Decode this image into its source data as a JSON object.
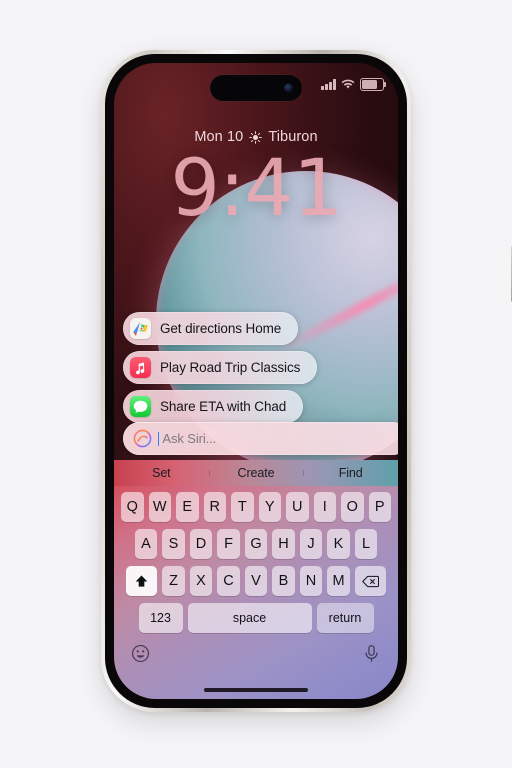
{
  "device": {
    "name": "iphone-15-pro",
    "frame_color": "#cfcac3"
  },
  "status_bar": {
    "signal_icon": "cellular-bars-icon",
    "wifi_icon": "wifi-icon",
    "battery_icon": "battery-icon"
  },
  "lock_screen": {
    "date": "Mon 10",
    "weather_icon": "sun-icon",
    "location": "Tiburon",
    "time": "9:41"
  },
  "siri": {
    "chips": [
      {
        "icon": "maps-app-icon",
        "label": "Get directions Home"
      },
      {
        "icon": "music-app-icon",
        "label": "Play Road Trip Classics"
      },
      {
        "icon": "messages-app-icon",
        "label": "Share ETA with Chad"
      }
    ],
    "input": {
      "icon": "siri-orb-icon",
      "placeholder": "Ask Siri...",
      "value": ""
    },
    "tabs": [
      {
        "label": "Set"
      },
      {
        "label": "Create"
      },
      {
        "label": "Find"
      }
    ]
  },
  "keyboard": {
    "row1": [
      "Q",
      "W",
      "E",
      "R",
      "T",
      "Y",
      "U",
      "I",
      "O",
      "P"
    ],
    "row2": [
      "A",
      "S",
      "D",
      "F",
      "G",
      "H",
      "J",
      "K",
      "L"
    ],
    "row3": [
      "Z",
      "X",
      "C",
      "V",
      "B",
      "N",
      "M"
    ],
    "shift_icon": "shift-up-arrow-icon",
    "backspace_icon": "backspace-delete-icon",
    "numbers_label": "123",
    "space_label": "space",
    "return_label": "return",
    "emoji_icon": "emoji-smiley-icon",
    "dictation_icon": "microphone-icon"
  },
  "colors": {
    "accent_pink": "#e9a9b2",
    "caret_blue": "#3b7df6",
    "keyboard_start": "#d4505f",
    "keyboard_end": "#8a86c6"
  }
}
